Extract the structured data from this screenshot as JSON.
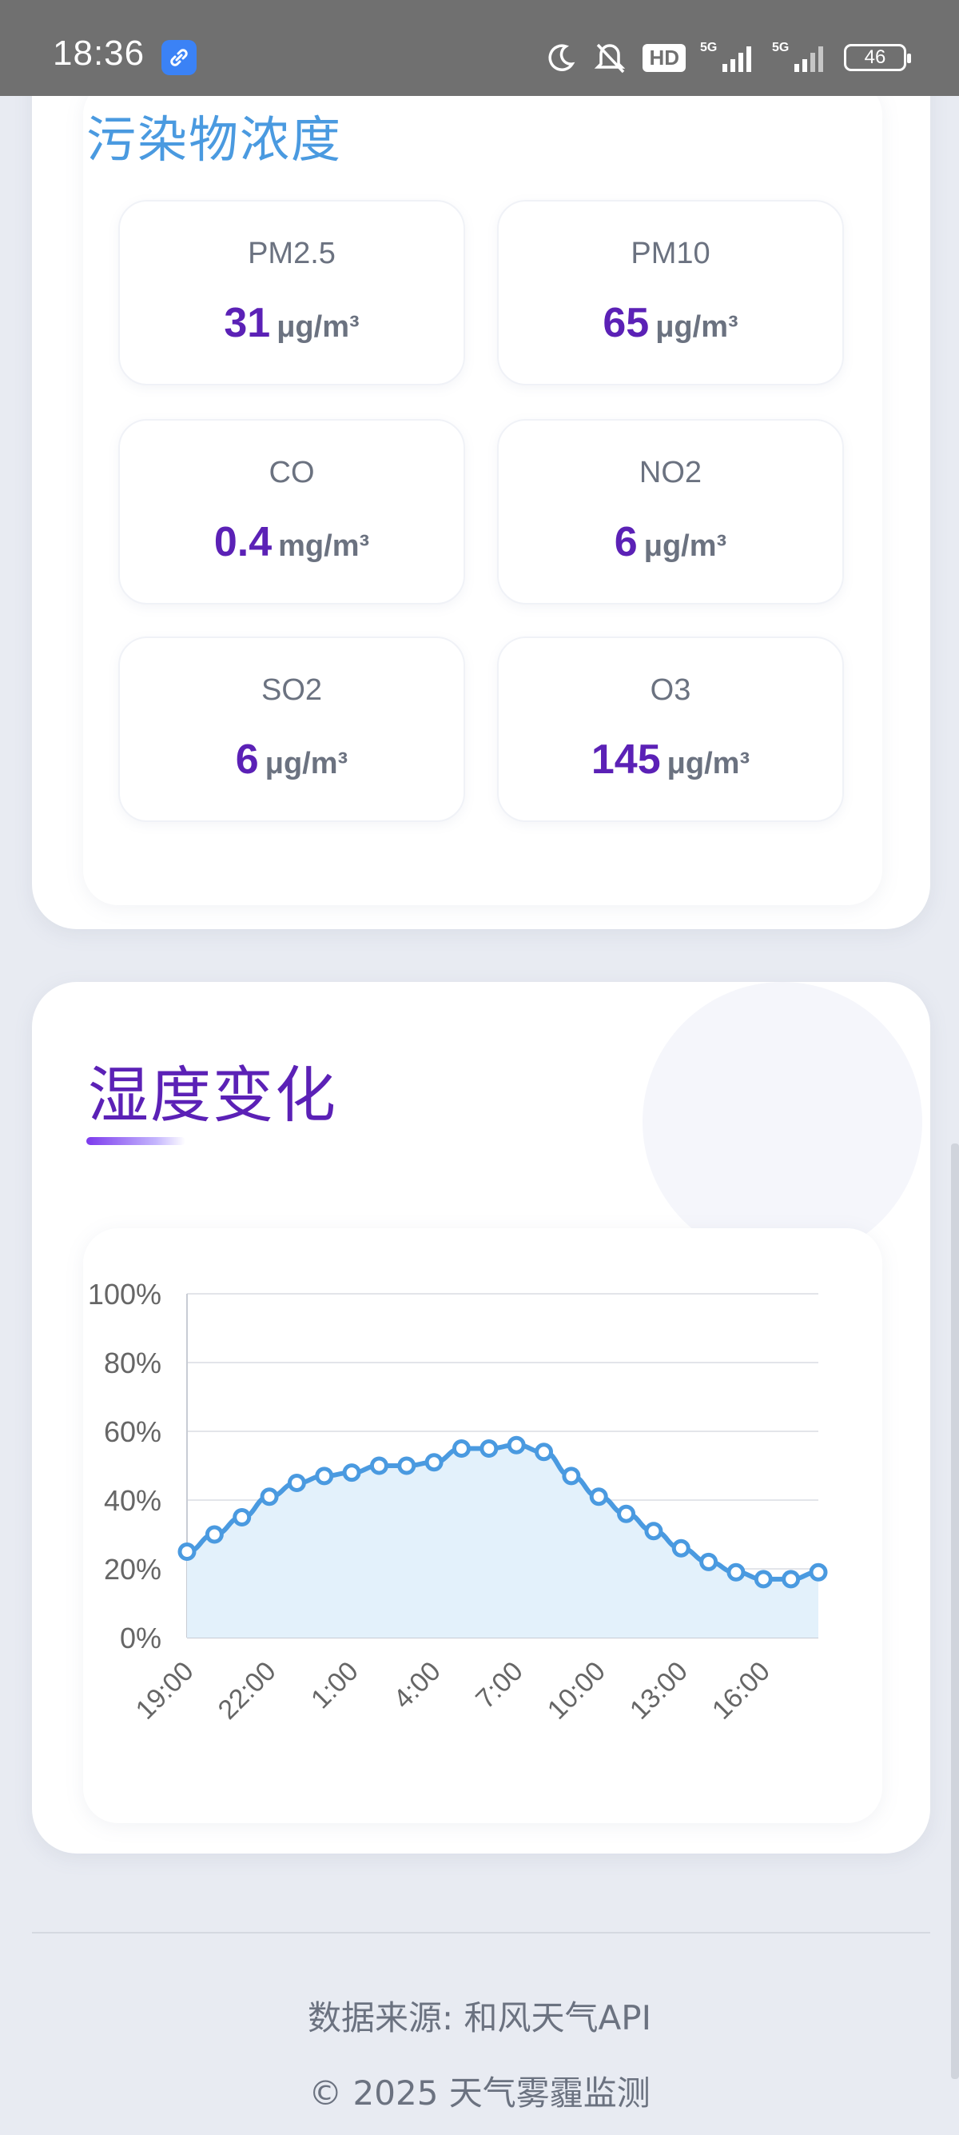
{
  "status_bar": {
    "time": "18:36",
    "hd_label": "HD",
    "network_1": "5G",
    "network_2": "5G",
    "battery": "46",
    "icons": [
      "link-icon",
      "moon-icon",
      "bell-off-icon",
      "hd-icon",
      "signal-icon",
      "signal-icon",
      "battery-icon"
    ]
  },
  "pollutants": {
    "heading": "污染物浓度",
    "items": [
      {
        "name": "PM2.5",
        "value": "31",
        "unit": "μg/m³"
      },
      {
        "name": "PM10",
        "value": "65",
        "unit": "μg/m³"
      },
      {
        "name": "CO",
        "value": "0.4",
        "unit": "mg/m³"
      },
      {
        "name": "NO2",
        "value": "6",
        "unit": "μg/m³"
      },
      {
        "name": "SO2",
        "value": "6",
        "unit": "μg/m³"
      },
      {
        "name": "O3",
        "value": "145",
        "unit": "μg/m³"
      }
    ]
  },
  "humidity": {
    "heading": "湿度变化"
  },
  "chart_data": {
    "type": "area",
    "title": "",
    "xlabel": "",
    "ylabel": "",
    "ylim": [
      0,
      100
    ],
    "y_ticks": [
      "0%",
      "20%",
      "40%",
      "60%",
      "80%",
      "100%"
    ],
    "x_tick_labels": [
      "19:00",
      "22:00",
      "1:00",
      "4:00",
      "7:00",
      "10:00",
      "13:00",
      "16:00"
    ],
    "x": [
      "19:00",
      "20:00",
      "21:00",
      "22:00",
      "23:00",
      "0:00",
      "1:00",
      "2:00",
      "3:00",
      "4:00",
      "5:00",
      "6:00",
      "7:00",
      "8:00",
      "9:00",
      "10:00",
      "11:00",
      "12:00",
      "13:00",
      "14:00",
      "15:00",
      "16:00",
      "17:00",
      "18:00"
    ],
    "series": [
      {
        "values": [
          25,
          30,
          35,
          41,
          45,
          47,
          48,
          50,
          50,
          51,
          55,
          55,
          56,
          54,
          47,
          41,
          36,
          31,
          26,
          22,
          19,
          17,
          17,
          19
        ]
      }
    ],
    "grid": true,
    "line_color": "#4a9ae0",
    "fill_color": "#e3f1fb"
  },
  "footer": {
    "source": "数据来源: 和风天气API",
    "copyright": "© 2025 天气雾霾监测"
  }
}
